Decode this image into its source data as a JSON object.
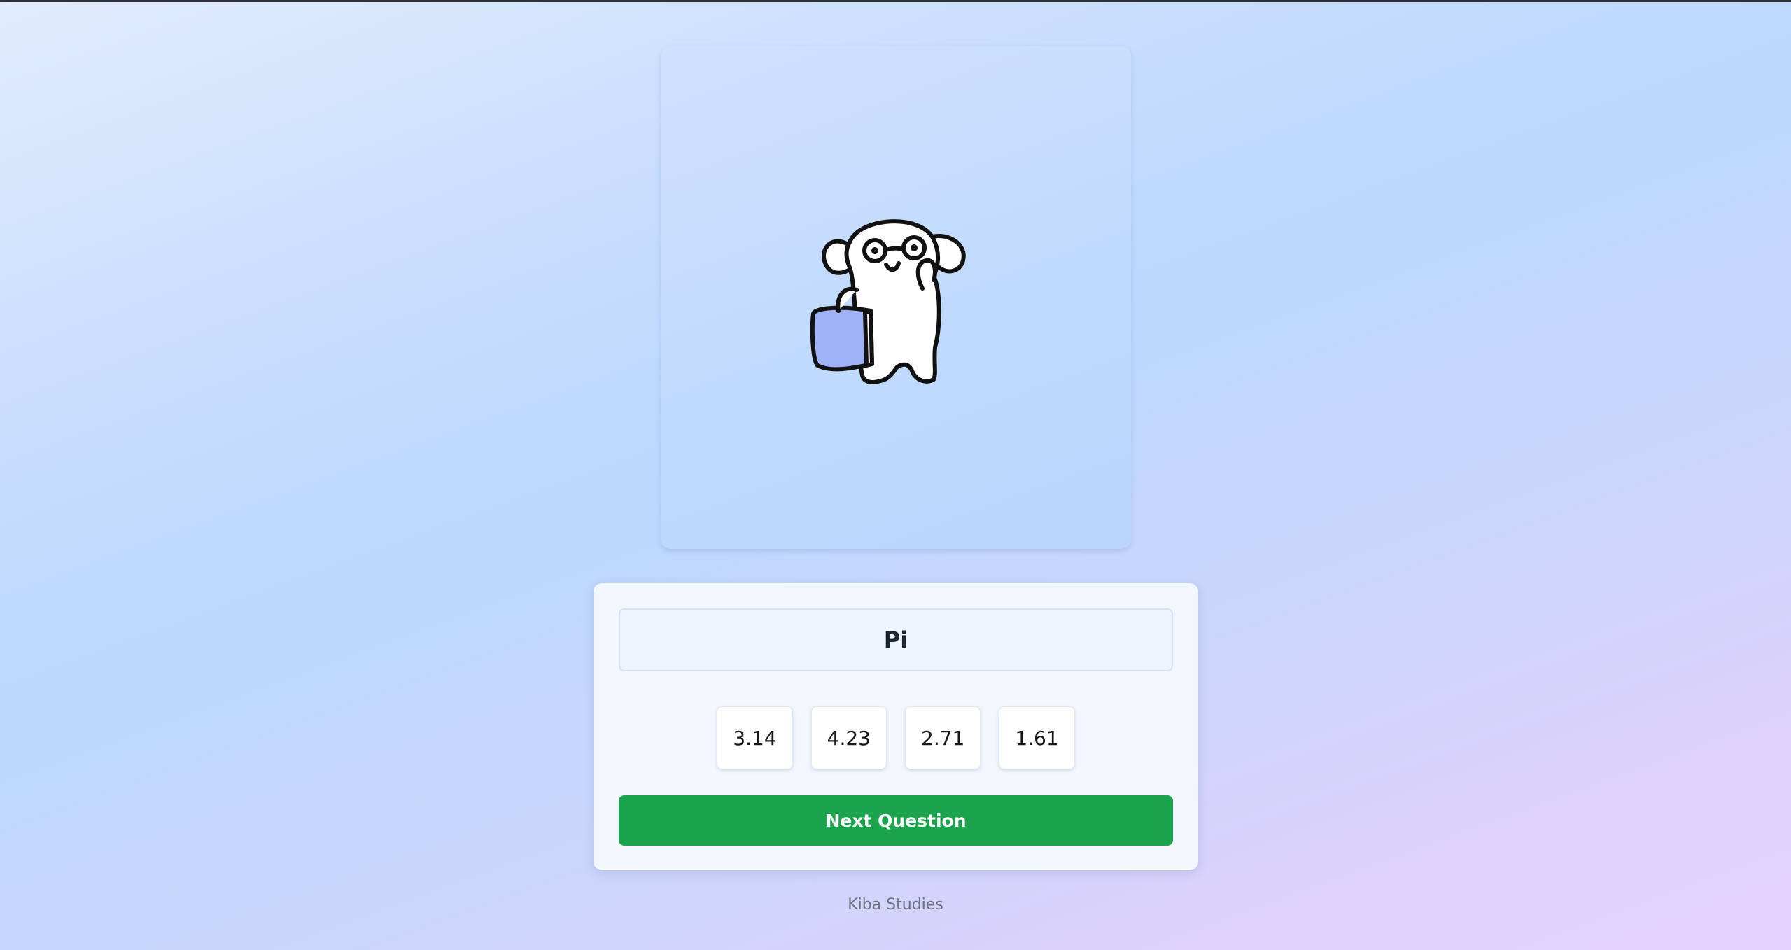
{
  "mascot": {
    "icon": "bear-with-glasses-holding-book-icon",
    "book_color": "#9fb1f7"
  },
  "quiz": {
    "question": "Pi",
    "answers": [
      "3.14",
      "4.23",
      "2.71",
      "1.61"
    ],
    "next_label": "Next Question",
    "accent_color": "#1ca34d"
  },
  "footer": {
    "text": "Kiba Studies"
  }
}
